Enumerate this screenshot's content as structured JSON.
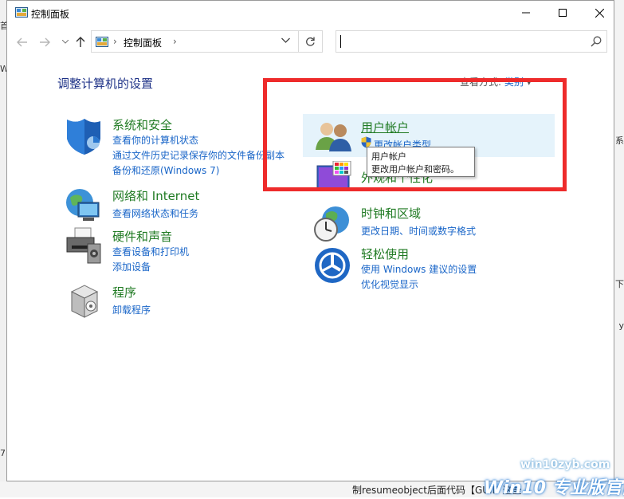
{
  "window": {
    "title": "控制面板"
  },
  "navigation": {
    "breadcrumb": "控制面板",
    "search_placeholder": ""
  },
  "main": {
    "heading": "调整计算机的设置",
    "view_by_label": "查看方式:",
    "view_by_value": "类别",
    "categories_left": [
      {
        "title": "系统和安全",
        "links": [
          "查看你的计算机状态",
          "通过文件历史记录保存你的文件备份副本",
          "备份和还原(Windows 7)"
        ]
      },
      {
        "title": "网络和 Internet",
        "links": [
          "查看网络状态和任务"
        ]
      },
      {
        "title": "硬件和声音",
        "links": [
          "查看设备和打印机",
          "添加设备"
        ]
      },
      {
        "title": "程序",
        "links": [
          "卸载程序"
        ]
      }
    ],
    "categories_right": [
      {
        "title": "用户帐户",
        "links": [
          "更改帐户类型"
        ]
      },
      {
        "title": "外观和个性化",
        "links": []
      },
      {
        "title": "时钟和区域",
        "links": [
          "更改日期、时间或数字格式"
        ]
      },
      {
        "title": "轻松使用",
        "links": [
          "使用 Windows 建议的设置",
          "优化视觉显示"
        ]
      }
    ]
  },
  "tooltip": {
    "line1": "用户帐户",
    "line2": "更改用户帐户和密码。"
  },
  "background": {
    "left_fragments": [
      "首",
      "W",
      "7"
    ],
    "right_fragments": [
      "系",
      "下",
      "y"
    ],
    "bottom_text": "制resumeobject后面代码【GUID 这些"
  },
  "watermark": {
    "site": "win10zyb.com",
    "brand": "Win10 专业版官网"
  },
  "colors": {
    "accent": "#1a66c8",
    "category_title": "#1f7a22",
    "heading": "#1e3287",
    "highlight": "#e5f3fb",
    "annotation": "#ee2b2b"
  }
}
